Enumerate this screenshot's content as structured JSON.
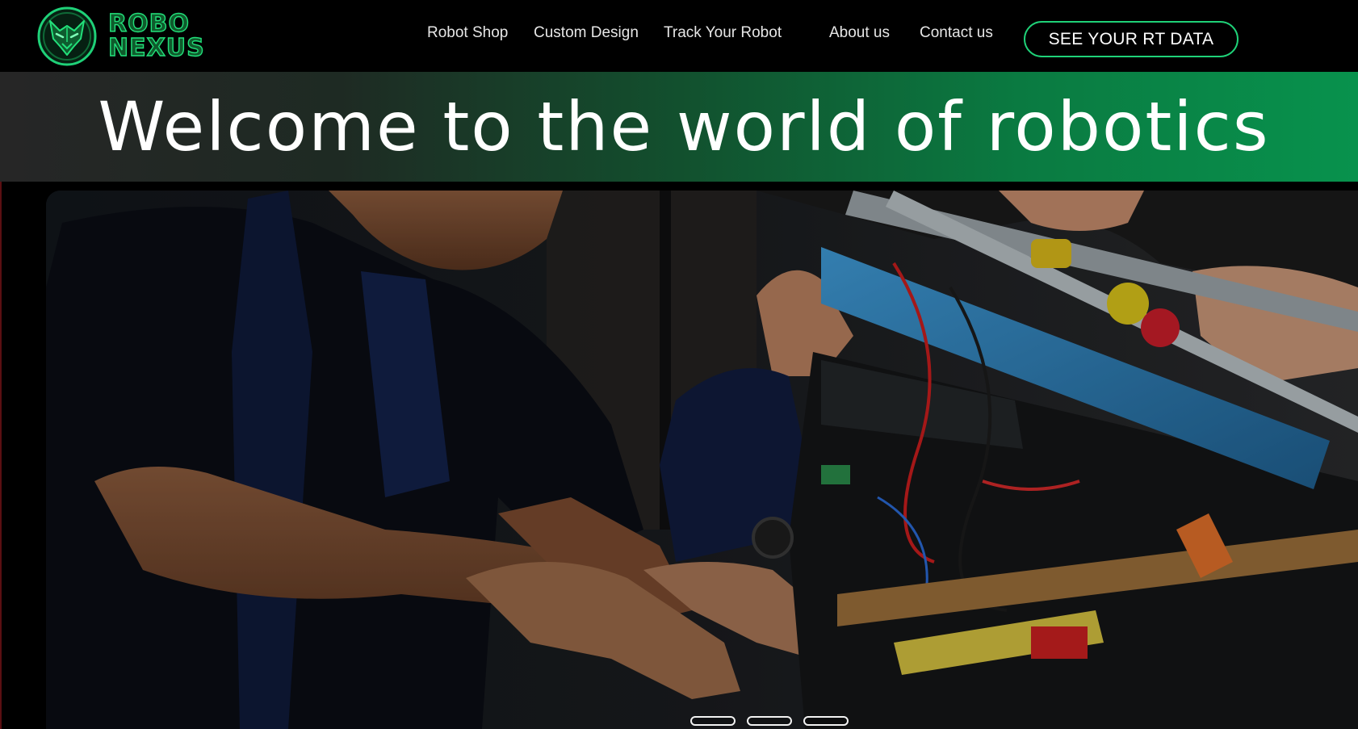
{
  "brand": {
    "line1": "ROBO",
    "line2": "NEXUS",
    "accent": "#22e07a",
    "icon": "wolf-head-logo-icon"
  },
  "nav": {
    "items": [
      {
        "label": "Robot Shop"
      },
      {
        "label": "Custom Design"
      },
      {
        "label": "Track Your Robot"
      },
      {
        "label": "About us"
      },
      {
        "label": "Contact us"
      }
    ],
    "cta_label": "SEE YOUR RT DATA"
  },
  "hero": {
    "title": "Welcome to the world of robotics",
    "gradient_end": "#08924d"
  },
  "carousel": {
    "slide_count": 3,
    "image": "photo-students-building-robot"
  }
}
